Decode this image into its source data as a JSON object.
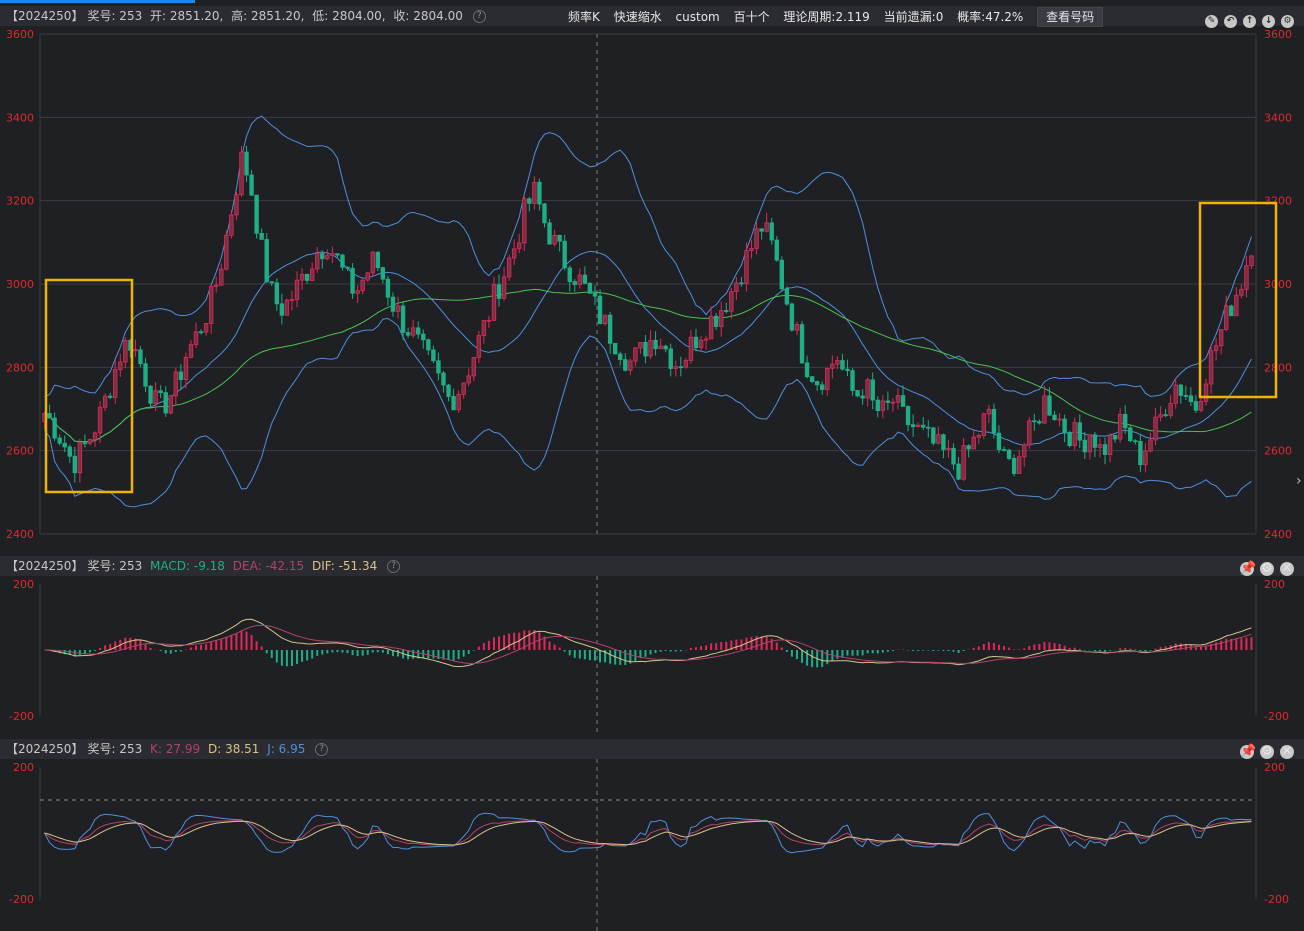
{
  "main_panel": {
    "issue": "【2024250】",
    "prize_label": "奖号: 253",
    "open_label": "开: 2851.20,",
    "high_label": "高: 2851.20,",
    "low_label": "低: 2804.00,",
    "close_label": "收: 2804.00",
    "center": {
      "freq_k": "频率K",
      "quick_shrink": "快速缩水",
      "custom": "custom",
      "hundred_ten": "百十个",
      "period": "理论周期:2.119",
      "miss": "当前遗漏:0",
      "prob": "概率:47.2%",
      "view_button": "查看号码"
    },
    "tool_icons": [
      "pencil-icon",
      "undo-icon",
      "arrow-up-icon",
      "arrow-down-icon",
      "gear-icon"
    ],
    "y_ticks": [
      "3600",
      "3400",
      "3200",
      "3000",
      "2800",
      "2600",
      "2400"
    ]
  },
  "macd_panel": {
    "issue": "【2024250】",
    "prize_label": "奖号: 253",
    "macd_label": "MACD: -9.18",
    "dea_label": "DEA: -42.15",
    "dif_label": "DIF: -51.34",
    "y_ticks": [
      "200",
      "-200"
    ],
    "tool_icons": [
      "pin-icon",
      "gear-icon",
      "close-icon"
    ]
  },
  "kdj_panel": {
    "issue": "【2024250】",
    "prize_label": "奖号: 253",
    "k_label": "K: 27.99",
    "d_label": "D: 38.51",
    "j_label": "J: 6.95",
    "y_ticks": [
      "200",
      "-200"
    ],
    "tool_icons": [
      "pin-icon",
      "gear-icon",
      "close-icon"
    ]
  },
  "colors": {
    "up": "#e0285a",
    "down": "#1fae86",
    "boll": "#4f8fd9",
    "ma": "#49c24f",
    "highlight": "#f0b400",
    "macd_text": "#1fae86",
    "dea_text": "#b0426c",
    "dif_text": "#d8c28a",
    "k_text": "#b0426c",
    "d_text": "#d8c28a",
    "j_text": "#4f8fd9",
    "tick_red": "#e0282d"
  },
  "chart_data": [
    {
      "type": "candlestick",
      "ylim": [
        2400,
        3600
      ],
      "y_ticks": [
        2400,
        2600,
        2800,
        3000,
        3200,
        3400,
        3600
      ],
      "close_guide": [
        2690,
        2660,
        2620,
        2570,
        2600,
        2640,
        2690,
        2760,
        2830,
        2870,
        2820,
        2760,
        2700,
        2720,
        2760,
        2830,
        2870,
        2920,
        2980,
        3080,
        3200,
        3310,
        3220,
        3080,
        2980,
        2940,
        2960,
        3000,
        3040,
        3080,
        3100,
        3060,
        3010,
        2980,
        3020,
        3060,
        3010,
        2950,
        2910,
        2880,
        2840,
        2800,
        2760,
        2720,
        2750,
        2800,
        2860,
        2920,
        2990,
        3040,
        3100,
        3180,
        3220,
        3150,
        3100,
        3060,
        3030,
        3000,
        2960,
        2920,
        2880,
        2850,
        2810,
        2830,
        2860,
        2880,
        2840,
        2810,
        2830,
        2870,
        2900,
        2920,
        2950,
        2990,
        3040,
        3090,
        3140,
        3100,
        3020,
        2940,
        2860,
        2800,
        2770,
        2790,
        2830,
        2770,
        2730,
        2760,
        2700,
        2690,
        2720,
        2680,
        2660,
        2640,
        2620,
        2600,
        2580,
        2560,
        2600,
        2640,
        2690,
        2620,
        2560,
        2580,
        2620,
        2660,
        2720,
        2700,
        2660,
        2640,
        2620,
        2650,
        2600,
        2620,
        2660,
        2640,
        2580,
        2620,
        2660,
        2720,
        2760,
        2740,
        2700,
        2780,
        2840,
        2900,
        2960,
        3010,
        3100
      ],
      "boll_upper": "upper band",
      "ma": "middle band"
    },
    {
      "type": "macd",
      "ylim": [
        -200,
        200
      ]
    },
    {
      "type": "kdj",
      "ylim": [
        -200,
        200
      ]
    }
  ]
}
